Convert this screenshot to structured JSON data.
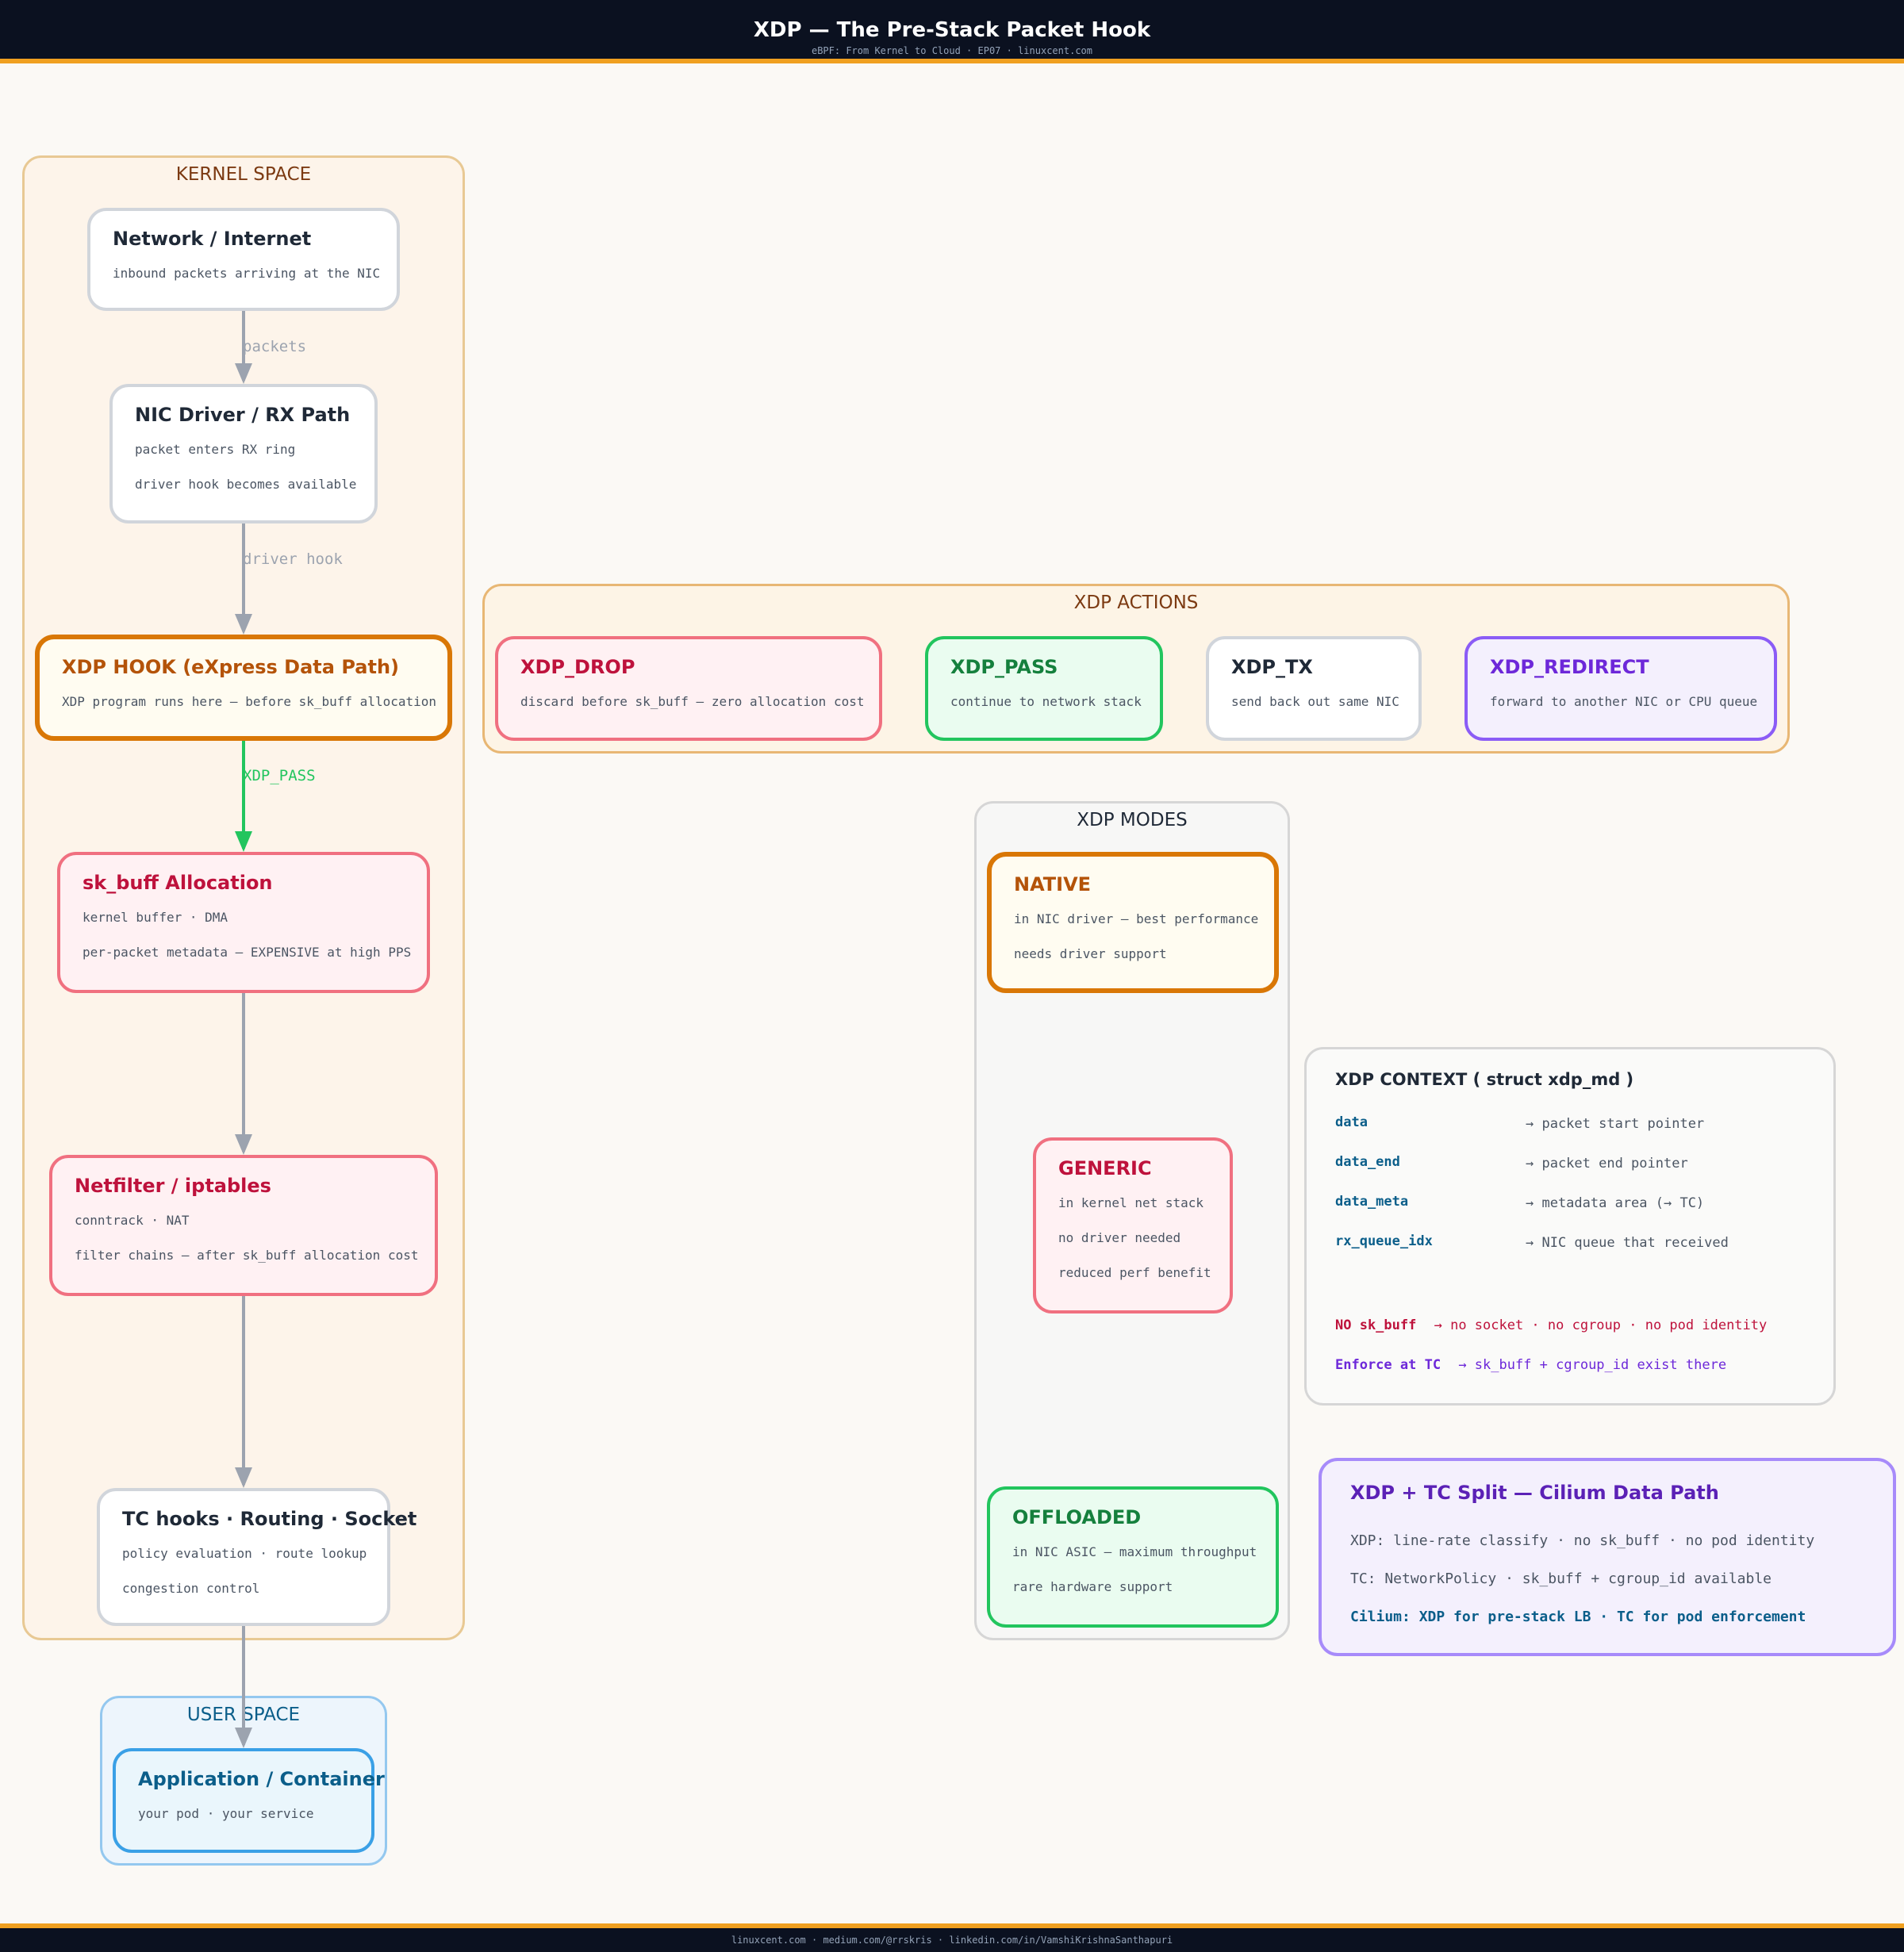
{
  "header": {
    "title": "XDP — The Pre-Stack Packet Hook",
    "subtitle": "eBPF: From Kernel to Cloud · EP07 · linuxcent.com"
  },
  "footer": {
    "text": "linuxcent.com · medium.com/@rrskris · linkedin.com/in/VamshiKrishnaSanthapuri"
  },
  "groups": {
    "kernel_space": "KERNEL SPACE",
    "xdp_actions": "XDP ACTIONS",
    "xdp_modes": "XDP MODES",
    "user_space": "USER SPACE"
  },
  "nodes": {
    "network": {
      "title": "Network / Internet",
      "lines": [
        "inbound packets arriving at the NIC"
      ]
    },
    "nic_driver": {
      "title": "NIC Driver / RX Path",
      "lines": [
        "packet enters RX ring",
        "driver hook becomes available"
      ]
    },
    "xdp_hook": {
      "title": "XDP HOOK  (eXpress Data Path)",
      "lines": [
        "XDP program runs here — before sk_buff allocation"
      ]
    },
    "sk_buff": {
      "title": "sk_buff Allocation",
      "lines": [
        "kernel buffer · DMA",
        "per-packet metadata — EXPENSIVE at high PPS"
      ]
    },
    "netfilter": {
      "title": "Netfilter / iptables",
      "lines": [
        "conntrack · NAT",
        "filter chains — after sk_buff allocation cost"
      ]
    },
    "tc_hooks": {
      "title": "TC hooks · Routing · Socket",
      "lines": [
        "policy evaluation · route lookup",
        "congestion control"
      ]
    },
    "application": {
      "title": "Application / Container",
      "lines": [
        "your pod · your service"
      ]
    },
    "xdp_drop": {
      "title": "XDP_DROP",
      "lines": [
        "discard before sk_buff — zero allocation cost"
      ]
    },
    "xdp_pass": {
      "title": "XDP_PASS",
      "lines": [
        "continue to network stack"
      ]
    },
    "xdp_tx": {
      "title": "XDP_TX",
      "lines": [
        "send back out same NIC"
      ]
    },
    "xdp_redirect": {
      "title": "XDP_REDIRECT",
      "lines": [
        "forward to another NIC or CPU queue"
      ]
    },
    "native": {
      "title": "NATIVE",
      "lines": [
        "in NIC driver — best performance",
        "needs driver support"
      ]
    },
    "generic": {
      "title": "GENERIC",
      "lines": [
        "in kernel net stack",
        "no driver needed",
        "reduced perf benefit"
      ]
    },
    "offloaded": {
      "title": "OFFLOADED",
      "lines": [
        "in NIC ASIC — maximum throughput",
        "rare hardware support"
      ]
    }
  },
  "edges": {
    "packets": "packets",
    "driver_hook": "driver hook",
    "xdp_pass": "XDP_PASS"
  },
  "context": {
    "title": "XDP CONTEXT  ( struct xdp_md )",
    "fields": [
      {
        "name": "data",
        "desc": "→ packet start pointer"
      },
      {
        "name": "data_end",
        "desc": "→ packet end pointer"
      },
      {
        "name": "data_meta",
        "desc": "→ metadata area (→ TC)"
      },
      {
        "name": "rx_queue_idx",
        "desc": "→ NIC queue that received"
      }
    ],
    "note1_key": "NO sk_buff",
    "note1_rest": "→  no socket · no cgroup · no pod identity",
    "note2_key": "Enforce at TC",
    "note2_rest": "→  sk_buff + cgroup_id exist there"
  },
  "split": {
    "title": "XDP + TC Split — Cilium Data Path",
    "line1": "XDP:  line-rate classify  ·  no sk_buff  ·  no pod identity",
    "line2": "TC:   NetworkPolicy  ·  sk_buff + cgroup_id available",
    "line3": "Cilium: XDP for pre-stack LB  ·  TC for pod enforcement"
  },
  "colors": {
    "orange": "#d97706",
    "pink": "#f07080",
    "green": "#22c55e",
    "purple": "#8b5cf6",
    "blue": "#3aa0e6",
    "gray": "#d1d5db"
  }
}
